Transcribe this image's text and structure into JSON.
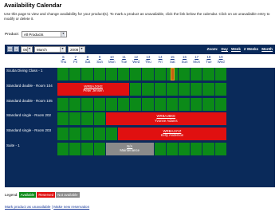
{
  "page": {
    "title": "Availability Calendar",
    "intro": "Use this page to view and change availability for your product(s). To mark a product as unavailable, click the link below the calendar. Click on an unavailable entry to modify or delete it."
  },
  "product_filter": {
    "label": "Product:",
    "value": "All Products"
  },
  "calendar": {
    "nav": {
      "prev_label": "<<",
      "next_label": ">",
      "day": "06",
      "month": "March",
      "year": "2008"
    },
    "zoom": {
      "label": "Zoom:",
      "day": "Day",
      "week": "Week",
      "two_weeks": "2 Weeks",
      "month": "Month"
    },
    "dates": [
      {
        "num": "6",
        "dow": "Thu"
      },
      {
        "num": "7",
        "dow": "Fri"
      },
      {
        "num": "8",
        "dow": "Sat"
      },
      {
        "num": "9",
        "dow": "Sun"
      },
      {
        "num": "10",
        "dow": "Mon"
      },
      {
        "num": "11",
        "dow": "Tue"
      },
      {
        "num": "12",
        "dow": "Wed"
      },
      {
        "num": "13",
        "dow": "Thu"
      },
      {
        "num": "14",
        "dow": "Fri"
      },
      {
        "num": "15",
        "dow": "Sat"
      },
      {
        "num": "16",
        "dow": "Sun"
      },
      {
        "num": "17",
        "dow": "Mon"
      },
      {
        "num": "18",
        "dow": "Tue"
      },
      {
        "num": "19",
        "dow": "Wed"
      }
    ],
    "rows": [
      {
        "name": "Scuba Diving Class - 1"
      },
      {
        "name": "Standard double - Room 104",
        "booking": {
          "ref": "WRBAJXKE",
          "guest": "Peter Jensen"
        }
      },
      {
        "name": "Standard double - Room 105"
      },
      {
        "name": "Standard single - Room 202",
        "booking": {
          "ref": "WRBAJBKE",
          "guest": "Yvonne Adams"
        }
      },
      {
        "name": "Standard single - Room 203",
        "booking": {
          "ref": "WRBAJ4YZ",
          "guest": "Kelly Anderson"
        }
      },
      {
        "name": "Suite - 1",
        "booking": {
          "ref": "N/A",
          "guest": "Maintenance"
        }
      }
    ]
  },
  "legend": {
    "label": "Legend:",
    "available": "Available",
    "reserved": "Reserved",
    "not_available": "Not available"
  },
  "footer": {
    "mark_unavailable": "Mark product as unavailable",
    "separator": " | ",
    "make_reservation": "Make new reservation"
  },
  "colors": {
    "available": "#0c8a18",
    "reserved": "#e01010",
    "not_available": "#8a8a8a",
    "header_bg": "#0a2a5a"
  }
}
